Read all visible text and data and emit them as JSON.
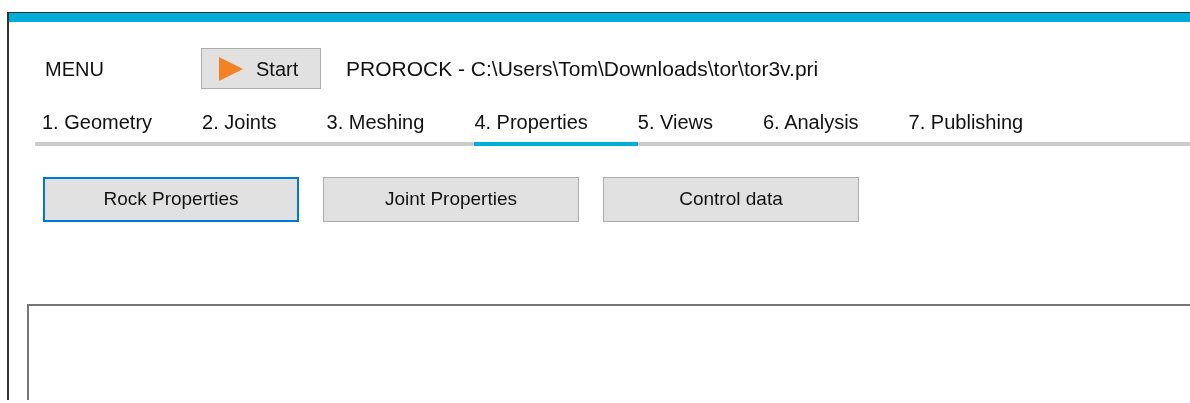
{
  "menu_label": "MENU",
  "start_button": {
    "label": "Start"
  },
  "title": "PROROCK - C:\\Users\\Tom\\Downloads\\tor\\tor3v.pri",
  "tabs": [
    {
      "label": "1. Geometry",
      "selected": false
    },
    {
      "label": "2. Joints",
      "selected": false
    },
    {
      "label": "3. Meshing",
      "selected": false
    },
    {
      "label": "4. Properties",
      "selected": true
    },
    {
      "label": "5. Views",
      "selected": false
    },
    {
      "label": "6. Analysis",
      "selected": false
    },
    {
      "label": "7. Publishing",
      "selected": false
    }
  ],
  "buttons": [
    {
      "label": "Rock Properties",
      "focused": true
    },
    {
      "label": "Joint Properties",
      "focused": false
    },
    {
      "label": "Control data",
      "focused": false
    }
  ]
}
